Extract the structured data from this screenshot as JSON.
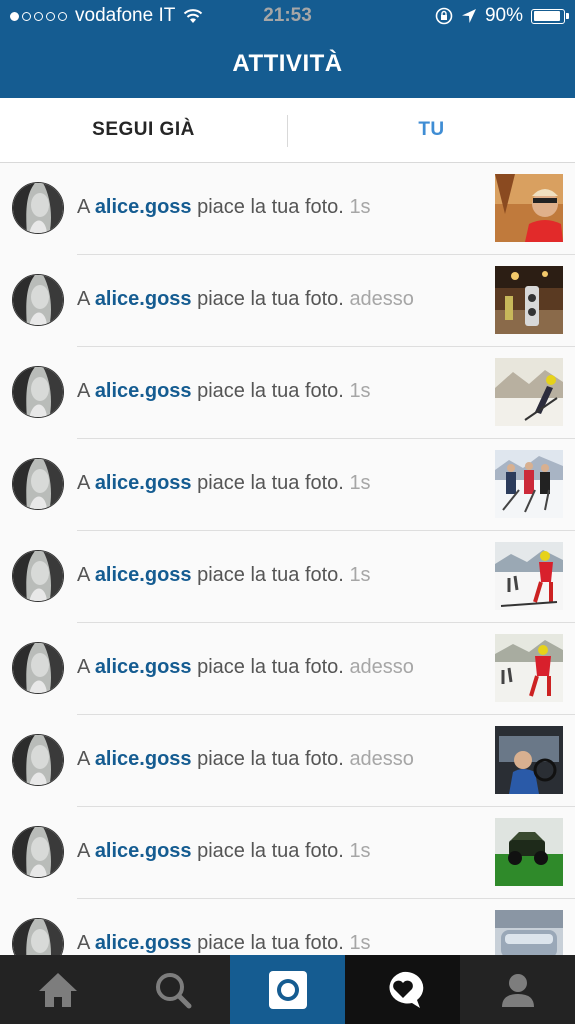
{
  "status_bar": {
    "carrier": "vodafone IT",
    "time": "21:53",
    "battery": "90%",
    "battery_level": 0.9,
    "signal_bars_filled": 1,
    "signal_bars_total": 5
  },
  "header": {
    "title": "ATTIVITÀ"
  },
  "tabs": {
    "following": "SEGUI GIÀ",
    "you": "TU",
    "active": "you"
  },
  "accent_colors": {
    "header": "#155c91",
    "active_tab": "#3f8dd4",
    "username": "#155c91",
    "timestamp": "#a6a6a6"
  },
  "feed": [
    {
      "prefix": "A",
      "user": "alice.goss",
      "action": "piace la tua foto.",
      "time": "1s",
      "thumb_icon": "autumn-selfie-photo"
    },
    {
      "prefix": "A",
      "user": "alice.goss",
      "action": "piace la tua foto.",
      "time": "adesso",
      "thumb_icon": "ski-boots-photo"
    },
    {
      "prefix": "A",
      "user": "alice.goss",
      "action": "piace la tua foto.",
      "time": "1s",
      "thumb_icon": "ski-mountain-photo"
    },
    {
      "prefix": "A",
      "user": "alice.goss",
      "action": "piace la tua foto.",
      "time": "1s",
      "thumb_icon": "ski-group-photo"
    },
    {
      "prefix": "A",
      "user": "alice.goss",
      "action": "piace la tua foto.",
      "time": "1s",
      "thumb_icon": "skier-photo"
    },
    {
      "prefix": "A",
      "user": "alice.goss",
      "action": "piace la tua foto.",
      "time": "adesso",
      "thumb_icon": "skier-photo"
    },
    {
      "prefix": "A",
      "user": "alice.goss",
      "action": "piace la tua foto.",
      "time": "adesso",
      "thumb_icon": "car-interior-photo"
    },
    {
      "prefix": "A",
      "user": "alice.goss",
      "action": "piace la tua foto.",
      "time": "1s",
      "thumb_icon": "off-road-photo"
    },
    {
      "prefix": "A",
      "user": "alice.goss",
      "action": "piace la tua foto.",
      "time": "1s",
      "thumb_icon": "snowy-cars-photo"
    }
  ],
  "tab_bar": [
    "home-icon",
    "search-icon",
    "camera-icon",
    "activity-icon",
    "profile-icon"
  ]
}
